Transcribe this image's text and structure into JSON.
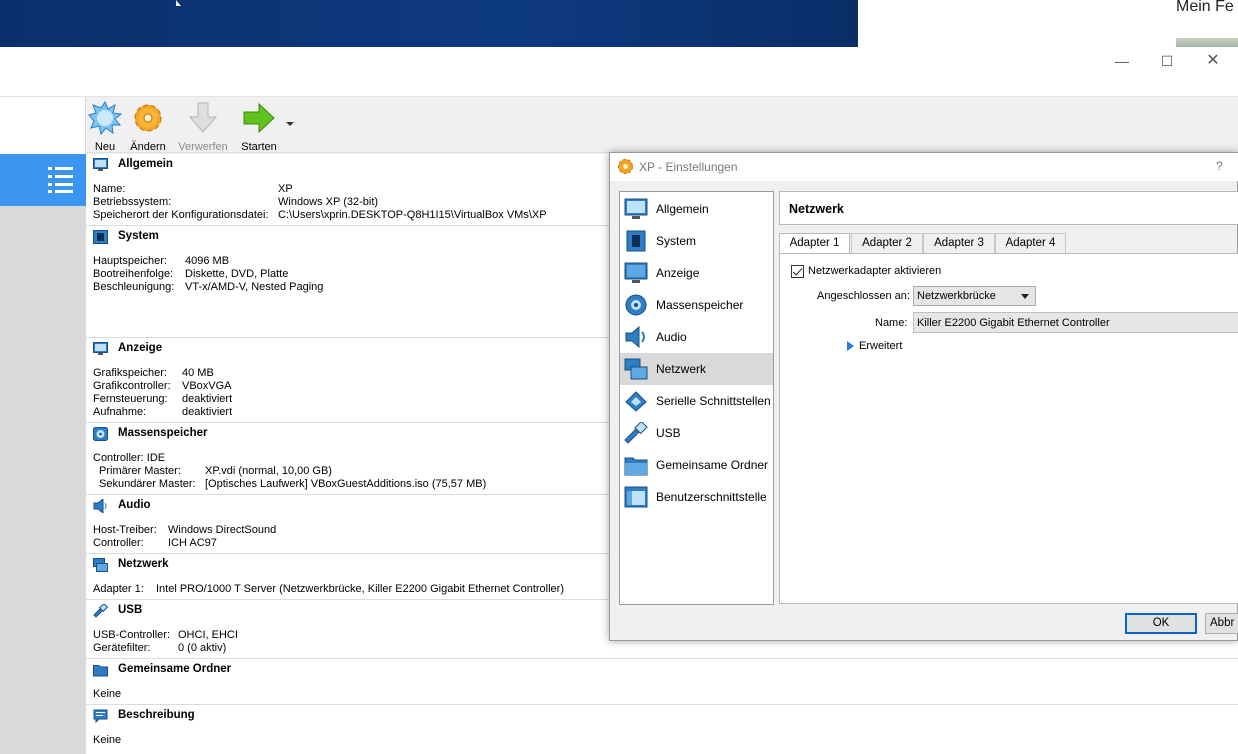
{
  "background": {
    "browser_title_fragment": "Mein Fe"
  },
  "window": {
    "controls": {
      "minimize": "—",
      "maximize": "☐",
      "close": "✕"
    }
  },
  "toolbar": {
    "new_label": "Neu",
    "change_label": "Ändern",
    "discard_label": "Verwerfen",
    "start_label": "Starten"
  },
  "details": {
    "general": {
      "title": "Allgemein",
      "name_key": "Name:",
      "name_value": "XP",
      "os_key": "Betriebssystem:",
      "os_value": "Windows XP (32-bit)",
      "config_key": "Speicherort der Konfigurationsdatei:",
      "config_value": "C:\\Users\\xprin.DESKTOP-Q8H1I15\\VirtualBox VMs\\XP"
    },
    "system": {
      "title": "System",
      "memory_key": "Hauptspeicher:",
      "memory_value": "4096 MB",
      "boot_key": "Bootreihenfolge:",
      "boot_value": "Diskette, DVD, Platte",
      "accel_key": "Beschleunigung:",
      "accel_value": "VT-x/AMD-V, Nested Paging"
    },
    "display": {
      "title": "Anzeige",
      "vram_key": "Grafikspeicher:",
      "vram_value": "40 MB",
      "controller_key": "Grafikcontroller:",
      "controller_value": "VBoxVGA",
      "remote_key": "Fernsteuerung:",
      "remote_value": "deaktiviert",
      "capture_key": "Aufnahme:",
      "capture_value": "deaktiviert"
    },
    "storage": {
      "title": "Massenspeicher",
      "controller_line": "Controller: IDE",
      "primary_key": "Primärer Master:",
      "primary_value": "XP.vdi (normal, 10,00 GB)",
      "secondary_key": "Sekundärer Master:",
      "secondary_value": "[Optisches Laufwerk] VBoxGuestAdditions.iso (75,57 MB)"
    },
    "audio": {
      "title": "Audio",
      "host_key": "Host-Treiber:",
      "host_value": "Windows DirectSound",
      "controller_key": "Controller:",
      "controller_value": "ICH AC97"
    },
    "network": {
      "title": "Netzwerk",
      "adapter_key": "Adapter 1:",
      "adapter_value": "Intel PRO/1000 T Server (Netzwerkbrücke, Killer E2200 Gigabit Ethernet Controller)"
    },
    "usb": {
      "title": "USB",
      "controller_key": "USB-Controller:",
      "controller_value": "OHCI, EHCI",
      "filter_key": "Gerätefilter:",
      "filter_value": "0 (0 aktiv)"
    },
    "shared": {
      "title": "Gemeinsame Ordner",
      "value": "Keine"
    },
    "description": {
      "title": "Beschreibung",
      "value": "Keine"
    }
  },
  "dialog": {
    "title": "XP - Einstellungen",
    "help": "?",
    "categories": [
      {
        "label": "Allgemein"
      },
      {
        "label": "System"
      },
      {
        "label": "Anzeige"
      },
      {
        "label": "Massenspeicher"
      },
      {
        "label": "Audio"
      },
      {
        "label": "Netzwerk"
      },
      {
        "label": "Serielle Schnittstellen"
      },
      {
        "label": "USB"
      },
      {
        "label": "Gemeinsame Ordner"
      },
      {
        "label": "Benutzerschnittstelle"
      }
    ],
    "selected_category": "Netzwerk",
    "page_title": "Netzwerk",
    "tabs": [
      "Adapter 1",
      "Adapter 2",
      "Adapter 3",
      "Adapter 4"
    ],
    "active_tab": "Adapter 1",
    "enable_label": "Netzwerkadapter aktivieren",
    "enable_checked": true,
    "attached_label": "Angeschlossen an:",
    "attached_value": "Netzwerkbrücke",
    "name_label": "Name:",
    "name_value": "Killer E2200 Gigabit Ethernet Controller",
    "advanced_label": "Erweitert",
    "ok_label": "OK",
    "cancel_label": "Abbr"
  },
  "colors": {
    "selection_blue": "#3a96f0",
    "desktop_blue": "#0e3a82",
    "ok_border": "#0a64c8"
  }
}
